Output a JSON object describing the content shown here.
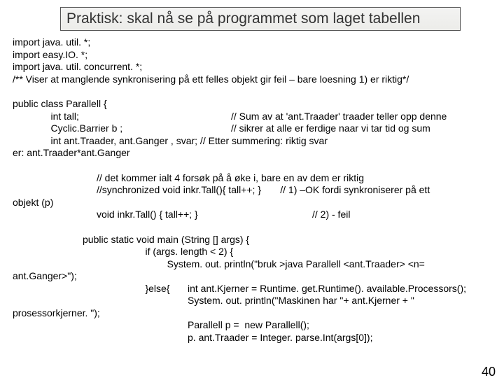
{
  "title": "Praktisk: skal nå se på programmet som laget tabellen",
  "code": {
    "l1": "import java. util. *;",
    "l2": "import easy.IO. *;",
    "l3": "import java. util. concurrent. *;",
    "l4": "/** Viser at manglende synkronisering på ett felles objekt gir feil – bare loesning 1) er riktig*/",
    "l5": "public class Parallell {",
    "l6a": "              int tall;",
    "l6b": "// Sum av at 'ant.Traader' traader teller opp denne",
    "l7a": "              Cyclic.Barrier b ;",
    "l7b": "// sikrer at alle er ferdige naar vi tar tid og sum",
    "l8": "              int ant.Traader, ant.Ganger , svar; // Etter summering: riktig svar",
    "l9": "er: ant.Traader*ant.Ganger",
    "l10": "// det kommer ialt 4 forsøk på å øke i, bare en av dem er riktig",
    "l11": "//synchronized void inkr.Tall(){ tall++; }       // 1) –OK fordi synkroniserer på ett",
    "l12": "objekt (p)",
    "l13a": "void inkr.Tall() { tall++; }",
    "l13b": "// 2) - feil",
    "l14": "public static void main (String [] args) {",
    "l15": "                       if (args. length < 2) {",
    "l16": "                               System. out. println(\"bruk >java Parallell <ant.Traader> <n=",
    "l17": "ant.Ganger>\");",
    "l18a": "                       }else{",
    "l18b": "int ant.Kjerner = Runtime. get.Runtime(). available.Processors();",
    "l19": "System. out. println(\"Maskinen har \"+ ant.Kjerner + \"",
    "l20": "prosessorkjerner. \");",
    "l21": "Parallell p =  new Parallell();",
    "l22": "p. ant.Traader = Integer. parse.Int(args[0]);"
  },
  "pageNumber": "40"
}
